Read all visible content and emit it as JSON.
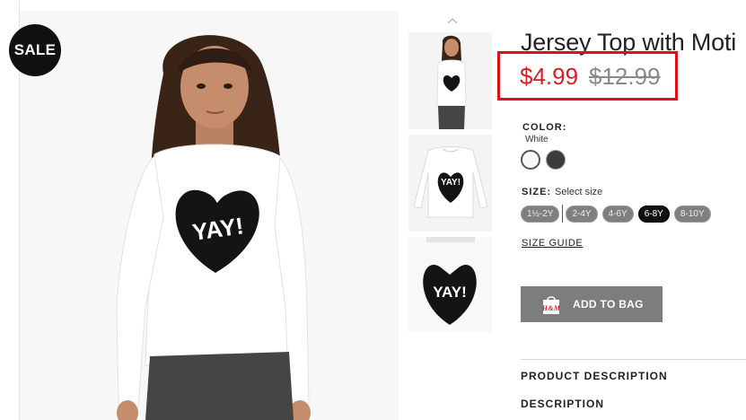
{
  "badge": {
    "label": "SALE"
  },
  "main_image": {
    "graphic_text": "YAY!"
  },
  "thumbnails": [
    {
      "name": "thumbnail-model",
      "graphic_text": "YAY!"
    },
    {
      "name": "thumbnail-product-flat",
      "graphic_text": "YAY!"
    },
    {
      "name": "thumbnail-detail",
      "graphic_text": "YAY!"
    }
  ],
  "product": {
    "title": "Jersey Top with Moti",
    "sale_price": "$4.99",
    "original_price": "$12.99"
  },
  "color": {
    "label": "COLOR:",
    "selected": "White",
    "swatches": [
      "#f7f7f7",
      "#3c3c3c"
    ]
  },
  "size": {
    "label": "SIZE:",
    "hint": "Select size",
    "options": [
      "1½-2Y",
      "2-4Y",
      "4-6Y",
      "6-8Y",
      "8-10Y"
    ],
    "selected": "6-8Y"
  },
  "links": {
    "size_guide": "SIZE GUIDE"
  },
  "actions": {
    "add_to_bag": "ADD TO BAG",
    "bag_icon_text": "H&M"
  },
  "description": {
    "product_heading": "PRODUCT DESCRIPTION",
    "heading": "DESCRIPTION"
  },
  "colors": {
    "sale_price": "#d41f24",
    "highlight_box": "#e0101b",
    "button": "#7d7d7d"
  }
}
